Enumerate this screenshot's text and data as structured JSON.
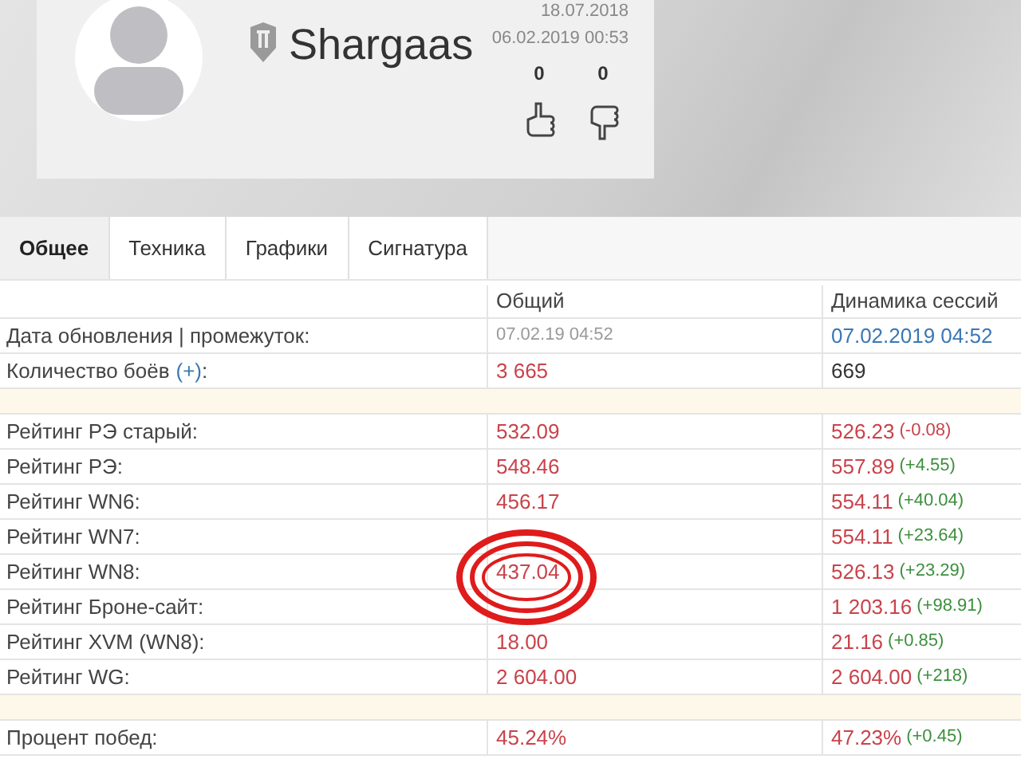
{
  "profile": {
    "name": "Shargaas",
    "dates": [
      "18.07.2018",
      "06.02.2019 00:53"
    ],
    "likes": "0",
    "dislikes": "0"
  },
  "tabs": [
    {
      "label": "Общее",
      "selected": true
    },
    {
      "label": "Техника",
      "selected": false
    },
    {
      "label": "Графики",
      "selected": false
    },
    {
      "label": "Сигнатура",
      "selected": false
    }
  ],
  "table": {
    "columns": [
      "Общий",
      "Динамика сессий"
    ],
    "rows": [
      {
        "kind": "data",
        "label": "Дата обновления | промежуток:",
        "general": {
          "text": "07.02.19 04:52",
          "color": "#9a9a9a"
        },
        "dynamic": {
          "text": "07.02.2019 04:52",
          "color": "#3a78b5"
        }
      },
      {
        "kind": "data",
        "label": "Количество боёв",
        "link": "(+)",
        "label_end": ":",
        "general": {
          "text": "3 665",
          "color": "#c9434b"
        },
        "dynamic": {
          "text": "669",
          "color": "#333333"
        }
      },
      {
        "kind": "spacer"
      },
      {
        "kind": "data",
        "label": "Рейтинг РЭ старый:",
        "general": {
          "text": "532.09",
          "color": "#c9434b"
        },
        "dynamic": {
          "text": "526.23",
          "color": "#c9434b"
        },
        "delta": {
          "text": "(-0.08)",
          "color": "#c9434b"
        }
      },
      {
        "kind": "data",
        "label": "Рейтинг РЭ:",
        "general": {
          "text": "548.46",
          "color": "#c9434b"
        },
        "dynamic": {
          "text": "557.89",
          "color": "#c9434b"
        },
        "delta": {
          "text": "(+4.55)",
          "color": "#3d8f3d"
        }
      },
      {
        "kind": "data",
        "label": "Рейтинг WN6:",
        "general": {
          "text": "456.17",
          "color": "#c9434b"
        },
        "dynamic": {
          "text": "554.11",
          "color": "#c9434b"
        },
        "delta": {
          "text": "(+40.04)",
          "color": "#3d8f3d"
        }
      },
      {
        "kind": "data",
        "label": "Рейтинг WN7:",
        "dynamic": {
          "text": "554.11",
          "color": "#c9434b"
        },
        "delta": {
          "text": "(+23.64)",
          "color": "#3d8f3d"
        }
      },
      {
        "kind": "data",
        "label": "Рейтинг WN8:",
        "general": {
          "text": "437.04",
          "color": "#c9434b"
        },
        "dynamic": {
          "text": "526.13",
          "color": "#c9434b"
        },
        "delta": {
          "text": "(+23.29)",
          "color": "#3d8f3d"
        }
      },
      {
        "kind": "data",
        "label": "Рейтинг Броне-сайт:",
        "dynamic": {
          "text": "1 203.16",
          "color": "#c9434b"
        },
        "delta": {
          "text": "(+98.91)",
          "color": "#3d8f3d"
        }
      },
      {
        "kind": "data",
        "label": "Рейтинг XVM (WN8):",
        "general": {
          "text": "18.00",
          "color": "#c9434b"
        },
        "dynamic": {
          "text": "21.16",
          "color": "#c9434b"
        },
        "delta": {
          "text": "(+0.85)",
          "color": "#3d8f3d"
        }
      },
      {
        "kind": "data",
        "label": "Рейтинг WG:",
        "general": {
          "text": "2 604.00",
          "color": "#c9434b"
        },
        "dynamic": {
          "text": "2 604.00",
          "color": "#c9434b"
        },
        "delta": {
          "text": "(+218)",
          "color": "#3d8f3d"
        }
      },
      {
        "kind": "spacer"
      },
      {
        "kind": "data",
        "label": "Процент побед:",
        "general": {
          "text": "45.24%",
          "color": "#c9434b"
        },
        "dynamic": {
          "text": "47.23%",
          "color": "#c9434b"
        },
        "delta": {
          "text": "(+0.45)",
          "color": "#3d8f3d"
        }
      }
    ]
  }
}
